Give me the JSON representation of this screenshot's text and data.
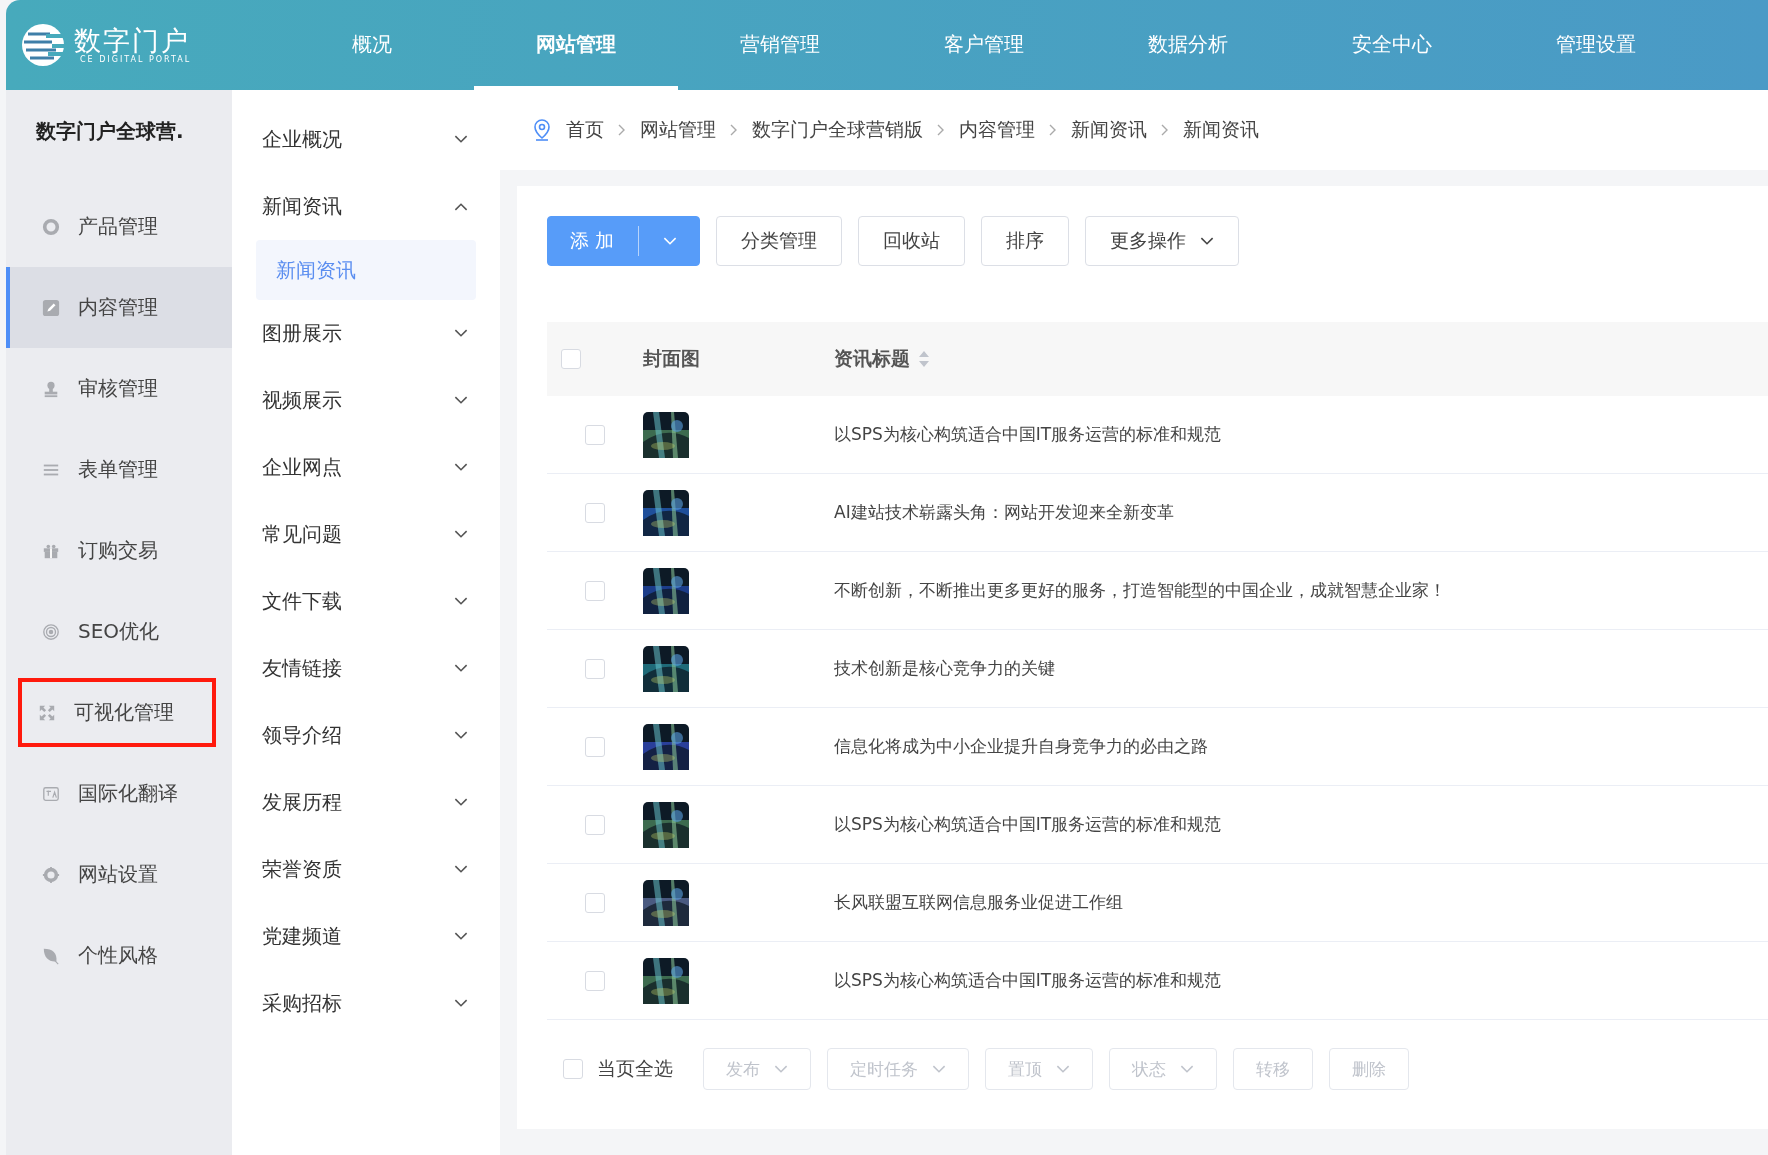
{
  "logo": {
    "name": "数字门户",
    "tagline": "CE DIGITAL PORTAL"
  },
  "top_nav": [
    {
      "label": "概况",
      "selected": false
    },
    {
      "label": "网站管理",
      "selected": true
    },
    {
      "label": "营销管理",
      "selected": false
    },
    {
      "label": "客户管理",
      "selected": false
    },
    {
      "label": "数据分析",
      "selected": false
    },
    {
      "label": "安全中心",
      "selected": false
    },
    {
      "label": "管理设置",
      "selected": false
    }
  ],
  "sidebar": {
    "title": "数字门户全球营.",
    "items": [
      {
        "label": "产品管理",
        "selected": false,
        "highlighted": false
      },
      {
        "label": "内容管理",
        "selected": true,
        "highlighted": false
      },
      {
        "label": "审核管理",
        "selected": false,
        "highlighted": false
      },
      {
        "label": "表单管理",
        "selected": false,
        "highlighted": false
      },
      {
        "label": "订购交易",
        "selected": false,
        "highlighted": false
      },
      {
        "label": "SEO优化",
        "selected": false,
        "highlighted": false
      },
      {
        "label": "可视化管理",
        "selected": false,
        "highlighted": true
      },
      {
        "label": "国际化翻译",
        "selected": false,
        "highlighted": false
      },
      {
        "label": "网站设置",
        "selected": false,
        "highlighted": false
      },
      {
        "label": "个性风格",
        "selected": false,
        "highlighted": false
      }
    ]
  },
  "submenu": [
    {
      "label": "企业概况",
      "expanded": false
    },
    {
      "label": "新闻资讯",
      "expanded": true,
      "children": [
        {
          "label": "新闻资讯",
          "selected": true
        }
      ]
    },
    {
      "label": "图册展示",
      "expanded": false
    },
    {
      "label": "视频展示",
      "expanded": false
    },
    {
      "label": "企业网点",
      "expanded": false
    },
    {
      "label": "常见问题",
      "expanded": false
    },
    {
      "label": "文件下载",
      "expanded": false
    },
    {
      "label": "友情链接",
      "expanded": false
    },
    {
      "label": "领导介绍",
      "expanded": false
    },
    {
      "label": "发展历程",
      "expanded": false
    },
    {
      "label": "荣誉资质",
      "expanded": false
    },
    {
      "label": "党建频道",
      "expanded": false
    },
    {
      "label": "采购招标",
      "expanded": false
    }
  ],
  "breadcrumb": [
    "首页",
    "网站管理",
    "数字门户全球营销版",
    "内容管理",
    "新闻资讯",
    "新闻资讯"
  ],
  "toolbar": [
    {
      "label": "添 加",
      "kind": "split"
    },
    {
      "label": "分类管理",
      "kind": "plain"
    },
    {
      "label": "回收站",
      "kind": "plain"
    },
    {
      "label": "排序",
      "kind": "plain"
    },
    {
      "label": "更多操作",
      "kind": "dropdown"
    }
  ],
  "table": {
    "columns": [
      "封面图",
      "资讯标题"
    ],
    "header_checked": false,
    "rows": [
      {
        "checked": false,
        "title": "以SPS为核心构筑适合中国IT服务运营的标准和规范"
      },
      {
        "checked": false,
        "title": "AI建站技术崭露头角：网站开发迎来全新变革"
      },
      {
        "checked": false,
        "title": "不断创新，不断推出更多更好的服务，打造智能型的中国企业，成就智慧企业家！"
      },
      {
        "checked": false,
        "title": "技术创新是核心竞争力的关键"
      },
      {
        "checked": false,
        "title": "信息化将成为中小企业提升自身竞争力的必由之路"
      },
      {
        "checked": false,
        "title": "以SPS为核心构筑适合中国IT服务运营的标准和规范"
      },
      {
        "checked": false,
        "title": "长风联盟互联网信息服务业促进工作组"
      },
      {
        "checked": false,
        "title": "以SPS为核心构筑适合中国IT服务运营的标准和规范"
      }
    ]
  },
  "footer": {
    "select_all": {
      "label": "当页全选",
      "checked": false
    },
    "actions": [
      {
        "label": "发布",
        "kind": "dropdown",
        "disabled": true
      },
      {
        "label": "定时任务",
        "kind": "dropdown",
        "disabled": true
      },
      {
        "label": "置顶",
        "kind": "dropdown",
        "disabled": true
      },
      {
        "label": "状态",
        "kind": "dropdown",
        "disabled": true
      },
      {
        "label": "转移",
        "kind": "plain",
        "disabled": true
      },
      {
        "label": "删除",
        "kind": "plain",
        "disabled": true
      }
    ]
  }
}
